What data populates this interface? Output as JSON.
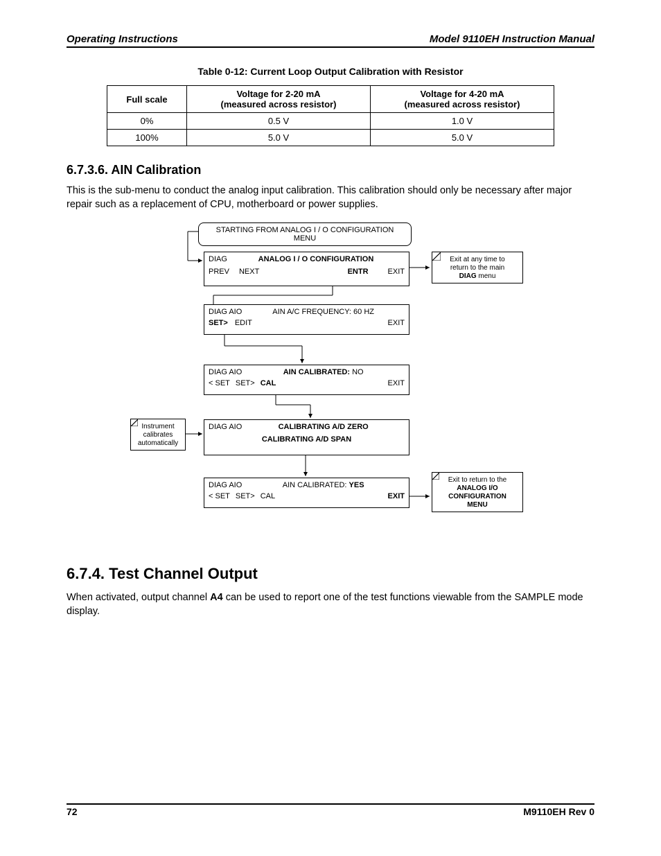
{
  "header": {
    "left": "Operating Instructions",
    "right": "Model 9110EH Instruction Manual"
  },
  "table": {
    "caption": "Table 0-12:  Current Loop Output Calibration with Resistor",
    "headers": [
      "Full scale",
      "Voltage for 2-20 mA\n(measured across resistor)",
      "Voltage for 4-20 mA\n(measured across resistor)"
    ],
    "rows": [
      [
        "0%",
        "0.5 V",
        "1.0 V"
      ],
      [
        "100%",
        "5.0 V",
        "5.0 V"
      ]
    ]
  },
  "sec1": {
    "heading": "6.7.3.6. AIN Calibration",
    "para": "This is the sub-menu to conduct the analog input calibration. This calibration should only be necessary after major repair such as a replacement of CPU, motherboard or power supplies."
  },
  "diagram": {
    "start": "STARTING FROM ANALOG I / O CONFIGURATION MENU",
    "note_right1_l1": "Exit at any time to",
    "note_right1_l2": "return to the main",
    "note_right1_l3": "DIAG",
    "note_right1_l3b": " menu",
    "note_left_l1": "Instrument",
    "note_left_l2": "calibrates",
    "note_left_l3": "automatically",
    "note_right2_l1": "Exit to return to the",
    "note_right2_l2": "ANALOG  I/O",
    "note_right2_l3": "CONFIGURATION",
    "note_right2_l4": "MENU",
    "s1": {
      "left": "DIAG",
      "center": "ANALOG I / O CONFIGURATION",
      "b_prev": "PREV",
      "b_next": "NEXT",
      "b_entr": "ENTR",
      "b_exit": "EXIT"
    },
    "s2": {
      "left": "DIAG AIO",
      "center": "AIN A/C FREQUENCY: 60 HZ",
      "b_set": "SET>",
      "b_edit": "EDIT",
      "b_exit": "EXIT"
    },
    "s3": {
      "left": "DIAG AIO",
      "center_pre": "AIN CALIBRATED:",
      "center_val": " NO",
      "b_lset": "< SET",
      "b_set": "SET>",
      "b_cal": "CAL",
      "b_exit": "EXIT"
    },
    "s4": {
      "left": "DIAG AIO",
      "line1": "CALIBRATING A/D ZERO",
      "line2": "CALIBRATING A/D SPAN"
    },
    "s5": {
      "left": "DIAG AIO",
      "center_pre": "AIN CALIBRATED: ",
      "center_val": "YES",
      "b_lset": "< SET",
      "b_set": "SET>",
      "b_cal": "CAL",
      "b_exit": "EXIT"
    }
  },
  "sec2": {
    "heading": "6.7.4. Test Channel Output",
    "para_pre": "When activated, output channel ",
    "para_bold": "A4",
    "para_post": " can be used to report one of the test functions viewable from the SAMPLE mode display."
  },
  "footer": {
    "left": "72",
    "right": "M9110EH Rev 0"
  },
  "chart_data": {
    "type": "table",
    "title": "Current Loop Output Calibration with Resistor",
    "columns": [
      "Full scale",
      "Voltage for 2-20 mA (V)",
      "Voltage for 4-20 mA (V)"
    ],
    "rows": [
      {
        "full_scale": "0%",
        "v_2_20mA": 0.5,
        "v_4_20mA": 1.0
      },
      {
        "full_scale": "100%",
        "v_2_20mA": 5.0,
        "v_4_20mA": 5.0
      }
    ]
  }
}
